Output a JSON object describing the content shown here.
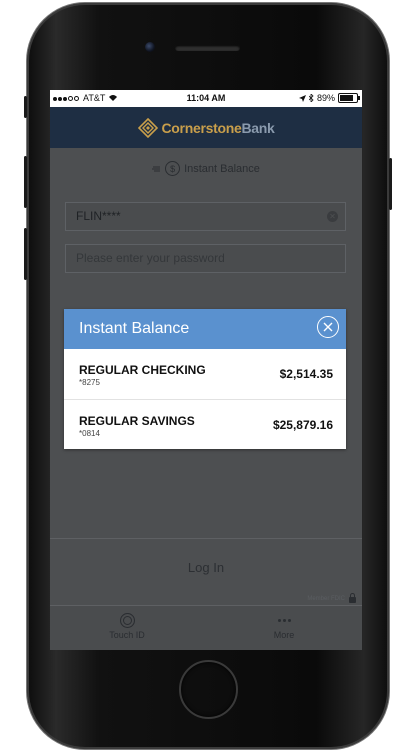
{
  "status_bar": {
    "carrier": "AT&T",
    "time": "11:04 AM",
    "battery": "89%"
  },
  "header": {
    "logo_part1": "Cornerstone",
    "logo_part2": "Bank"
  },
  "login_form": {
    "instant_balance_link": "Instant Balance",
    "username_value": "FLIN****",
    "password_placeholder": "Please enter your password",
    "login_label": "Log In",
    "insured_text": "Member FDIC"
  },
  "modal": {
    "title": "Instant Balance",
    "accounts": [
      {
        "name": "REGULAR CHECKING",
        "number": "*8275",
        "balance": "$2,514.35"
      },
      {
        "name": "REGULAR SAVINGS",
        "number": "*0814",
        "balance": "$25,879.16"
      }
    ]
  },
  "tabbar": {
    "touch_id": "Touch ID",
    "more": "More"
  },
  "colors": {
    "header_bg": "#1e2e43",
    "modal_header": "#5a91cf",
    "logo_gold": "#c99f4b"
  }
}
